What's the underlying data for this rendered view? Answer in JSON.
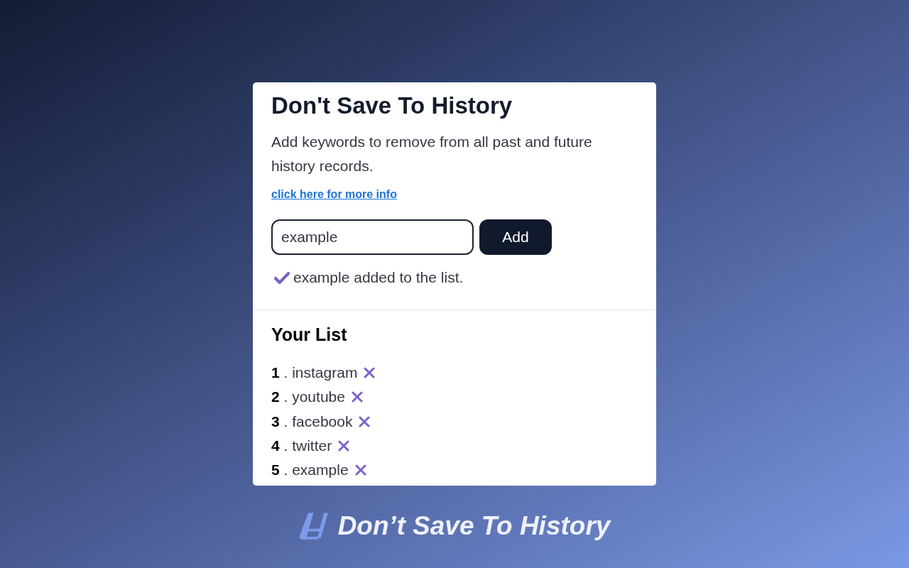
{
  "card": {
    "title": "Don't Save To History",
    "description": "Add keywords to remove from all past and future history records.",
    "info_link": "click here for more info",
    "keyword_input": {
      "value": "example"
    },
    "add_button": "Add",
    "status": {
      "kind": "success",
      "text": "example added to the list."
    },
    "list_title": "Your List",
    "list_items": [
      {
        "text": "**1** . instagram"
      },
      {
        "text": "**2** . youtube"
      },
      {
        "text": "**3** . facebook"
      },
      {
        "text": "**4** . twitter"
      },
      {
        "text": "**5** . example"
      }
    ]
  },
  "footer": {
    "title": "Don’t Save To History"
  }
}
